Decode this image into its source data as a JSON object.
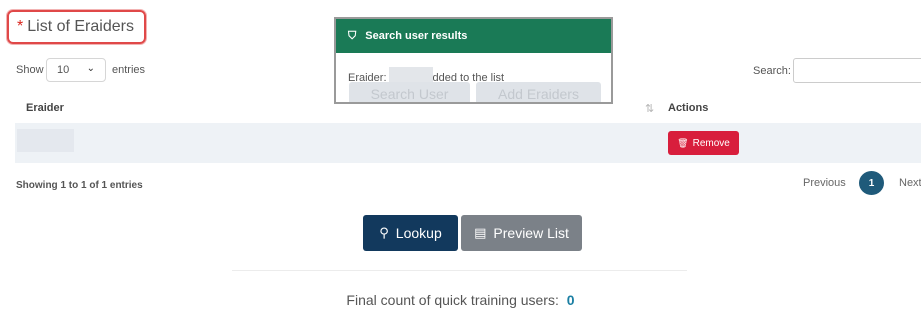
{
  "header": {
    "required_marker": "*",
    "title": "List of Eraiders"
  },
  "table_controls": {
    "show_label": "Show",
    "page_size": "10",
    "entries_label": "entries",
    "search_label": "Search:",
    "search_value": ""
  },
  "table": {
    "columns": [
      "Eraider",
      "Actions"
    ],
    "rows": [
      {
        "eraider": "",
        "action_label": "Remove"
      }
    ]
  },
  "pagination": {
    "info": "Showing 1 to 1 of 1 entries",
    "previous": "Previous",
    "current_page": "1",
    "next": "Next"
  },
  "buttons": {
    "lookup": "Lookup",
    "preview_list": "Preview List"
  },
  "footer": {
    "final_count_label": "Final count of quick training users:",
    "final_count_value": "0"
  },
  "toast": {
    "title": "Search user results",
    "message_prefix": "Eraider:",
    "message_suffix": "dded to the list",
    "background_button_1": "Search User",
    "background_button_2": "Add Eraiders"
  },
  "icons": {
    "toast_icon": "shield-check-icon",
    "remove_icon": "trash-icon",
    "lookup_icon": "users-search-icon",
    "preview_icon": "list-preview-icon",
    "sort_icon": "sort-icon",
    "chevron": "chevron-down-icon"
  },
  "colors": {
    "toast_header": "#1a7a56",
    "remove_button": "#d81e3c",
    "lookup_button": "#12395d",
    "preview_button": "#7b8188",
    "page_active": "#1f5a7a",
    "count_value": "#1b7fa3",
    "title_border": "#e04848"
  }
}
